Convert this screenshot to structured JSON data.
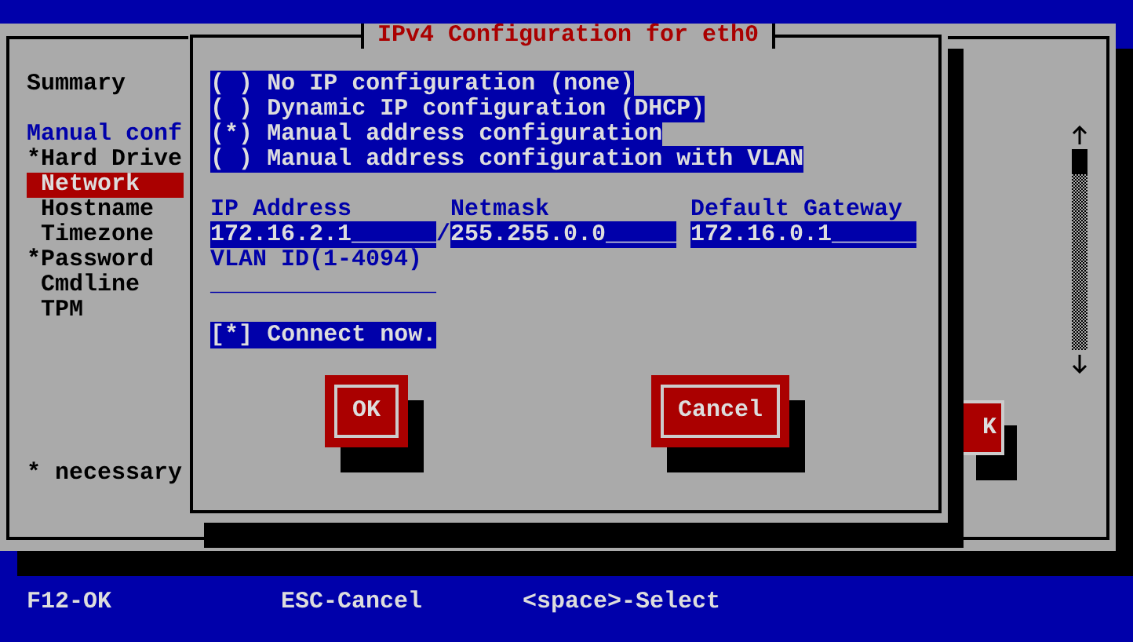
{
  "background_window": {
    "summary": "Summary",
    "sidebar": {
      "header": "Manual conf",
      "items": [
        {
          "label": "Hard Drive",
          "flag": "*",
          "selected": false
        },
        {
          "label": "Network",
          "selected": true
        },
        {
          "label": "Hostname",
          "selected": false
        },
        {
          "label": "Timezone",
          "selected": false
        },
        {
          "label": "Password",
          "flag": "*",
          "selected": false
        },
        {
          "label": "Cmdline",
          "selected": false
        },
        {
          "label": "TPM",
          "selected": false
        }
      ]
    },
    "footnote": "* necessary",
    "ok_button": "K"
  },
  "dialog": {
    "title": "IPv4 Configuration for eth0",
    "marks": {
      "on": "*"
    },
    "radio": {
      "open": "(",
      "close": ")",
      "options": [
        {
          "label": "No IP configuration (none)",
          "selected": false
        },
        {
          "label": "Dynamic IP configuration (DHCP)",
          "selected": false
        },
        {
          "label": "Manual address configuration",
          "selected": true
        },
        {
          "label": "Manual address configuration with VLAN",
          "selected": false
        }
      ]
    },
    "fields": [
      {
        "label": "IP Address",
        "value": "172.16.2.1______",
        "trail": "/"
      },
      {
        "label": "Netmask",
        "value": "255.255.0.0_____"
      },
      {
        "label": "Default Gateway",
        "value": "172.16.0.1______"
      }
    ],
    "vlan": {
      "label": "VLAN ID(1-4094)",
      "value": "________________"
    },
    "connect": {
      "open": "[",
      "close": "]",
      "label": "Connect now.",
      "checked": true
    },
    "buttons": [
      "OK",
      "Cancel"
    ]
  },
  "status_bar": [
    "F12-OK",
    "ESC-Cancel",
    "<space>-Select"
  ]
}
